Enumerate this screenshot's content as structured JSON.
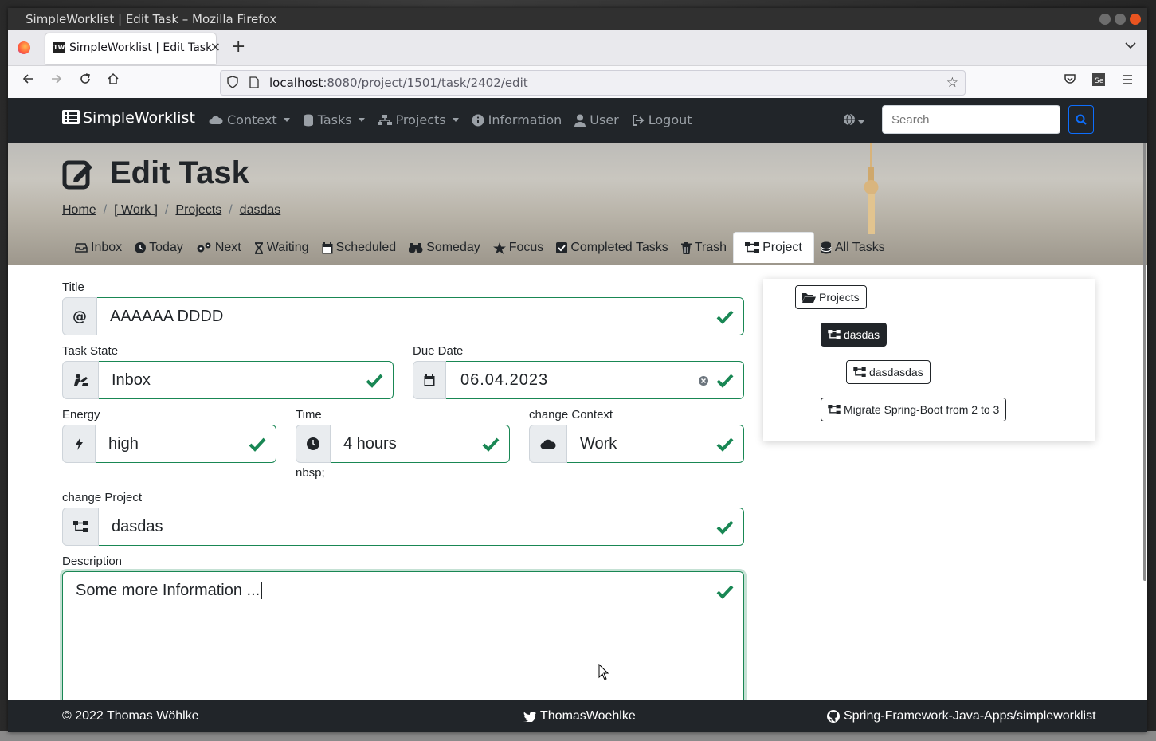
{
  "window": {
    "title": "SimpleWorklist | Edit Task – Mozilla Firefox"
  },
  "browser": {
    "tab_title": "SimpleWorklist | Edit Task",
    "tab_favicon": "TW",
    "url_host": "localhost",
    "url_rest": ":8080/project/1501/task/2402/edit"
  },
  "nav": {
    "brand": "SimpleWorklist",
    "items": [
      {
        "label": "Context",
        "icon": "cloud-icon",
        "dropdown": true
      },
      {
        "label": "Tasks",
        "icon": "database-icon",
        "dropdown": true
      },
      {
        "label": "Projects",
        "icon": "sitemap-icon",
        "dropdown": true
      },
      {
        "label": "Information",
        "icon": "info-icon",
        "dropdown": false
      },
      {
        "label": "User",
        "icon": "user-icon",
        "dropdown": false
      },
      {
        "label": "Logout",
        "icon": "logout-icon",
        "dropdown": false
      }
    ],
    "search_placeholder": "Search"
  },
  "page": {
    "title": "Edit Task",
    "breadcrumb": [
      "Home",
      "[ Work ]",
      "Projects",
      "dasdas"
    ],
    "tabs": [
      "Inbox",
      "Today",
      "Next",
      "Waiting",
      "Scheduled",
      "Someday",
      "Focus",
      "Completed Tasks",
      "Trash",
      "Project",
      "All Tasks"
    ],
    "active_tab": "Project"
  },
  "form": {
    "title_label": "Title",
    "title_value": "AAAAAA DDDD",
    "task_state_label": "Task State",
    "task_state_value": "Inbox",
    "due_date_label": "Due Date",
    "due_date_value": "06.04.2023",
    "energy_label": "Energy",
    "energy_value": "high",
    "time_label": "Time",
    "time_value": "4 hours",
    "context_label": "change Context",
    "context_value": "Work",
    "stray_text": "nbsp;",
    "project_label": "change Project",
    "project_value": "dasdas",
    "description_label": "Description",
    "description_value": "Some more Information ..."
  },
  "tree": {
    "root": "Projects",
    "nodes": [
      "dasdas",
      "dasdasdas",
      "Migrate Spring-Boot from 2 to 3"
    ]
  },
  "footer": {
    "copyright": "© 2022 Thomas Wöhlke",
    "twitter": "ThomasWoehlke",
    "github": "Spring-Framework-Java-Apps/simpleworklist"
  },
  "colors": {
    "valid": "#198754",
    "dark": "#212529",
    "primary": "#0d6efd"
  }
}
